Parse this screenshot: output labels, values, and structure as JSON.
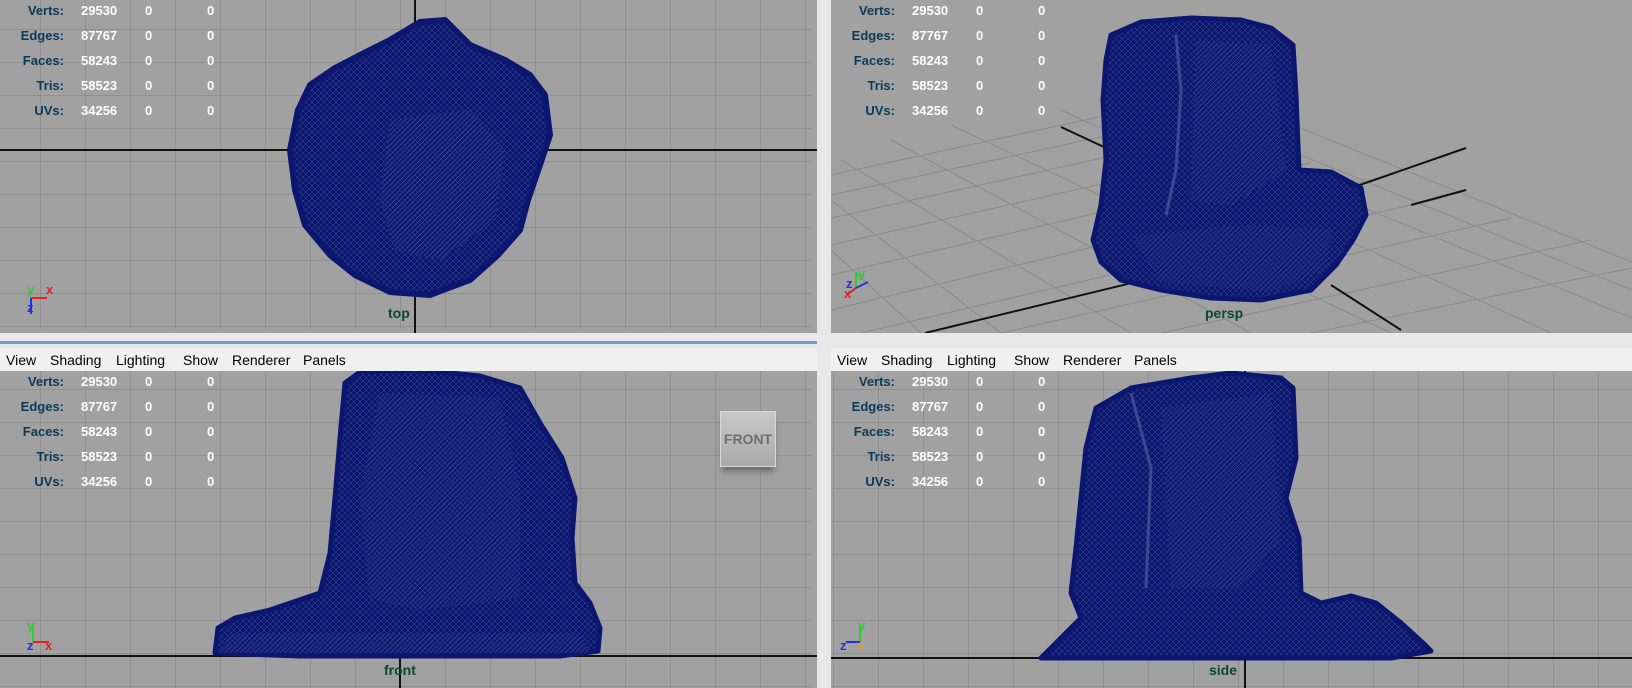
{
  "menu": [
    "View",
    "Shading",
    "Lighting",
    "Show",
    "Renderer",
    "Panels"
  ],
  "hud_rows": [
    {
      "label": "Verts:",
      "v1": "29530",
      "v2": "0",
      "v3": "0"
    },
    {
      "label": "Edges:",
      "v1": "87767",
      "v2": "0",
      "v3": "0"
    },
    {
      "label": "Faces:",
      "v1": "58243",
      "v2": "0",
      "v3": "0"
    },
    {
      "label": "Tris:",
      "v1": "58523",
      "v2": "0",
      "v3": "0"
    },
    {
      "label": "UVs:",
      "v1": "34256",
      "v2": "0",
      "v3": "0"
    }
  ],
  "viewports": {
    "top": {
      "camera": "top"
    },
    "persp": {
      "camera": "persp"
    },
    "front": {
      "camera": "front",
      "viewcube": "FRONT"
    },
    "side": {
      "camera": "side"
    }
  },
  "axes": {
    "x": "x",
    "y": "y",
    "z": "z"
  },
  "colors": {
    "viewport_bg": "#a1a1a1",
    "grid": "#7f7f7f",
    "mesh": "#0b1670",
    "axis_x": "#e22222",
    "axis_y": "#2ecc2e",
    "axis_z": "#2233dd"
  }
}
